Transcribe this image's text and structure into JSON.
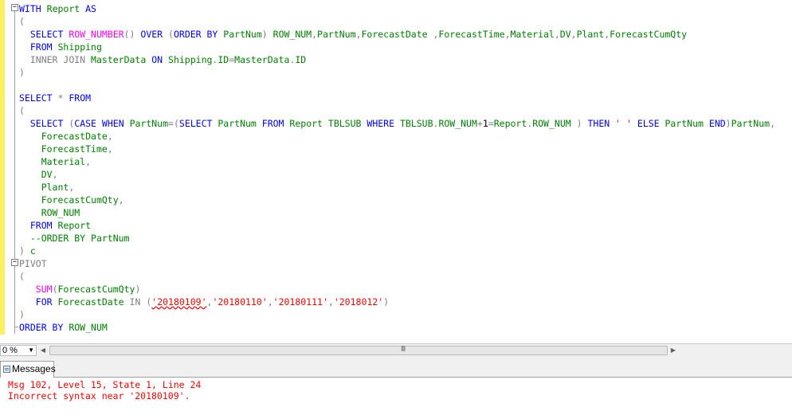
{
  "editor": {
    "lines": [
      [
        {
          "t": "WITH",
          "c": "kw"
        },
        {
          "t": " "
        },
        {
          "t": "Report",
          "c": "gn"
        },
        {
          "t": " "
        },
        {
          "t": "AS",
          "c": "kw"
        }
      ],
      [
        {
          "t": "(",
          "c": "gy"
        }
      ],
      [
        {
          "t": "  "
        },
        {
          "t": "SELECT",
          "c": "kw"
        },
        {
          "t": " "
        },
        {
          "t": "ROW_NUMBER",
          "c": "fn"
        },
        {
          "t": "()",
          "c": "gy"
        },
        {
          "t": " "
        },
        {
          "t": "OVER",
          "c": "kw"
        },
        {
          "t": " "
        },
        {
          "t": "(",
          "c": "gy"
        },
        {
          "t": "ORDER BY",
          "c": "kw"
        },
        {
          "t": " "
        },
        {
          "t": "PartNum",
          "c": "gn"
        },
        {
          "t": ")",
          "c": "gy"
        },
        {
          "t": " "
        },
        {
          "t": "ROW_NUM",
          "c": "gn"
        },
        {
          "t": ",",
          "c": "gy"
        },
        {
          "t": "PartNum",
          "c": "gn"
        },
        {
          "t": ",",
          "c": "gy"
        },
        {
          "t": "ForecastDate",
          "c": "gn"
        },
        {
          "t": " ",
          "c": "gy"
        },
        {
          "t": ",",
          "c": "gy"
        },
        {
          "t": "ForecastTime",
          "c": "gn"
        },
        {
          "t": ",",
          "c": "gy"
        },
        {
          "t": "Material",
          "c": "gn"
        },
        {
          "t": ",",
          "c": "gy"
        },
        {
          "t": "DV",
          "c": "gn"
        },
        {
          "t": ",",
          "c": "gy"
        },
        {
          "t": "Plant",
          "c": "gn"
        },
        {
          "t": ",",
          "c": "gy"
        },
        {
          "t": "ForecastCumQty",
          "c": "gn"
        }
      ],
      [
        {
          "t": "  "
        },
        {
          "t": "FROM",
          "c": "kw"
        },
        {
          "t": " "
        },
        {
          "t": "Shipping",
          "c": "gn"
        }
      ],
      [
        {
          "t": "  "
        },
        {
          "t": "INNER JOIN",
          "c": "gy"
        },
        {
          "t": " "
        },
        {
          "t": "MasterData",
          "c": "gn"
        },
        {
          "t": " "
        },
        {
          "t": "ON",
          "c": "kw"
        },
        {
          "t": " "
        },
        {
          "t": "Shipping",
          "c": "gn"
        },
        {
          "t": ".",
          "c": "gy"
        },
        {
          "t": "ID",
          "c": "gn"
        },
        {
          "t": "=",
          "c": "gy"
        },
        {
          "t": "MasterData",
          "c": "gn"
        },
        {
          "t": ".",
          "c": "gy"
        },
        {
          "t": "ID",
          "c": "gn"
        }
      ],
      [
        {
          "t": ")",
          "c": "gy"
        }
      ],
      [],
      [
        {
          "t": "SELECT",
          "c": "kw"
        },
        {
          "t": " "
        },
        {
          "t": "*",
          "c": "gy"
        },
        {
          "t": " "
        },
        {
          "t": "FROM",
          "c": "kw"
        }
      ],
      [
        {
          "t": "(",
          "c": "gy"
        }
      ],
      [
        {
          "t": "  "
        },
        {
          "t": "SELECT",
          "c": "kw"
        },
        {
          "t": " "
        },
        {
          "t": "(",
          "c": "gy"
        },
        {
          "t": "CASE",
          "c": "kw"
        },
        {
          "t": " "
        },
        {
          "t": "WHEN",
          "c": "kw"
        },
        {
          "t": " "
        },
        {
          "t": "PartNum",
          "c": "gn"
        },
        {
          "t": "=(",
          "c": "gy"
        },
        {
          "t": "SELECT",
          "c": "kw"
        },
        {
          "t": " "
        },
        {
          "t": "PartNum",
          "c": "gn"
        },
        {
          "t": " "
        },
        {
          "t": "FROM",
          "c": "kw"
        },
        {
          "t": " "
        },
        {
          "t": "Report",
          "c": "gn"
        },
        {
          "t": " "
        },
        {
          "t": "TBLSUB",
          "c": "gn"
        },
        {
          "t": " "
        },
        {
          "t": "WHERE",
          "c": "kw"
        },
        {
          "t": " "
        },
        {
          "t": "TBLSUB",
          "c": "gn"
        },
        {
          "t": ".",
          "c": "gy"
        },
        {
          "t": "ROW_NUM",
          "c": "gn"
        },
        {
          "t": "+",
          "c": "gy"
        },
        {
          "t": "1"
        },
        {
          "t": "=",
          "c": "gy"
        },
        {
          "t": "Report",
          "c": "gn"
        },
        {
          "t": ".",
          "c": "gy"
        },
        {
          "t": "ROW_NUM",
          "c": "gn"
        },
        {
          "t": " "
        },
        {
          "t": ")",
          "c": "gy"
        },
        {
          "t": " "
        },
        {
          "t": "THEN",
          "c": "kw"
        },
        {
          "t": " "
        },
        {
          "t": "' '",
          "c": "st"
        },
        {
          "t": " "
        },
        {
          "t": "ELSE",
          "c": "kw"
        },
        {
          "t": " "
        },
        {
          "t": "PartNum",
          "c": "gn"
        },
        {
          "t": " "
        },
        {
          "t": "END",
          "c": "kw"
        },
        {
          "t": ")",
          "c": "gy"
        },
        {
          "t": "PartNum",
          "c": "gn"
        },
        {
          "t": ",",
          "c": "gy"
        }
      ],
      [
        {
          "t": "    "
        },
        {
          "t": "ForecastDate",
          "c": "gn"
        },
        {
          "t": ",",
          "c": "gy"
        }
      ],
      [
        {
          "t": "    "
        },
        {
          "t": "ForecastTime",
          "c": "gn"
        },
        {
          "t": ",",
          "c": "gy"
        }
      ],
      [
        {
          "t": "    "
        },
        {
          "t": "Material",
          "c": "gn"
        },
        {
          "t": ",",
          "c": "gy"
        }
      ],
      [
        {
          "t": "    "
        },
        {
          "t": "DV",
          "c": "gn"
        },
        {
          "t": ",",
          "c": "gy"
        }
      ],
      [
        {
          "t": "    "
        },
        {
          "t": "Plant",
          "c": "gn"
        },
        {
          "t": ",",
          "c": "gy"
        }
      ],
      [
        {
          "t": "    "
        },
        {
          "t": "ForecastCumQty",
          "c": "gn"
        },
        {
          "t": ",",
          "c": "gy"
        }
      ],
      [
        {
          "t": "    "
        },
        {
          "t": "ROW_NUM",
          "c": "gn"
        }
      ],
      [
        {
          "t": "  "
        },
        {
          "t": "FROM",
          "c": "kw"
        },
        {
          "t": " "
        },
        {
          "t": "Report",
          "c": "gn"
        }
      ],
      [
        {
          "t": "  "
        },
        {
          "t": "--ORDER BY PartNum",
          "c": "gn"
        }
      ],
      [
        {
          "t": ")",
          "c": "gy"
        },
        {
          "t": " "
        },
        {
          "t": "c",
          "c": "gn"
        }
      ],
      [
        {
          "t": "PIVOT",
          "c": "gy"
        }
      ],
      [
        {
          "t": "(",
          "c": "gy"
        }
      ],
      [
        {
          "t": "   "
        },
        {
          "t": "SUM",
          "c": "fn"
        },
        {
          "t": "(",
          "c": "gy"
        },
        {
          "t": "ForecastCumQty",
          "c": "gn"
        },
        {
          "t": ")",
          "c": "gy"
        }
      ],
      [
        {
          "t": "   "
        },
        {
          "t": "FOR",
          "c": "kw"
        },
        {
          "t": " "
        },
        {
          "t": "ForecastDate",
          "c": "gn"
        },
        {
          "t": " "
        },
        {
          "t": "IN",
          "c": "gy"
        },
        {
          "t": " "
        },
        {
          "t": "(",
          "c": "gy"
        },
        {
          "t": "'20180109'",
          "c": "st",
          "sq": true
        },
        {
          "t": ",",
          "c": "gy"
        },
        {
          "t": "'20180110'",
          "c": "st"
        },
        {
          "t": ",",
          "c": "gy"
        },
        {
          "t": "'20180111'",
          "c": "st"
        },
        {
          "t": ",",
          "c": "gy"
        },
        {
          "t": "'2018012'",
          "c": "st"
        },
        {
          "t": ")",
          "c": "gy"
        }
      ],
      [
        {
          "t": ")",
          "c": "gy"
        }
      ],
      [
        {
          "t": "ORDER BY",
          "c": "kw"
        },
        {
          "t": " "
        },
        {
          "t": "ROW_NUM",
          "c": "gn"
        }
      ]
    ]
  },
  "zoom": {
    "value": "0 %",
    "dropdown_icon": "triangle-down-icon"
  },
  "scrollbar": {
    "left_icon": "triangle-left-icon",
    "right_icon": "triangle-right-icon",
    "grip": "III"
  },
  "messages_tab": {
    "label": "Messages",
    "icon": "messages-icon"
  },
  "messages": [
    "Msg 102, Level 15, State 1, Line 24",
    "Incorrect syntax near '20180109'."
  ],
  "colors": {
    "keyword": "#0000ff",
    "function": "#ff00ff",
    "operator": "#808080",
    "identifier": "#008000",
    "string": "#ff0000",
    "error": "#ff0000",
    "margin": "#ffee62"
  }
}
